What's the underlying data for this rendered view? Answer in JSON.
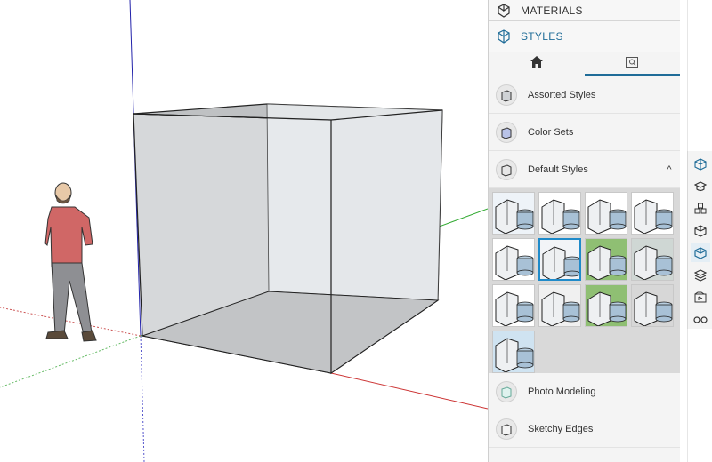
{
  "tray": {
    "materials_title": "MATERIALS",
    "styles_title": "STYLES",
    "tabs": [
      {
        "icon": "home-icon"
      },
      {
        "icon": "search-icon"
      }
    ],
    "rows": [
      {
        "label": "Assorted Styles"
      },
      {
        "label": "Color Sets"
      },
      {
        "label": "Default Styles",
        "expanded_symbol": "^"
      }
    ],
    "default_styles_thumbnails": 13,
    "selected_thumbnail_index": 5,
    "more_rows": [
      {
        "label": "Photo Modeling"
      },
      {
        "label": "Sketchy Edges"
      }
    ]
  },
  "toolbar": {
    "icons": [
      "entity-info-icon",
      "instructor-icon",
      "components-icon",
      "materials-icon",
      "styles-icon",
      "layers-icon",
      "scenes-icon",
      "shadows-icon"
    ]
  },
  "colors": {
    "accent": "#1f6c98",
    "axis_red": "#cc3333",
    "axis_green": "#33aa33",
    "axis_blue": "#3333cc"
  }
}
